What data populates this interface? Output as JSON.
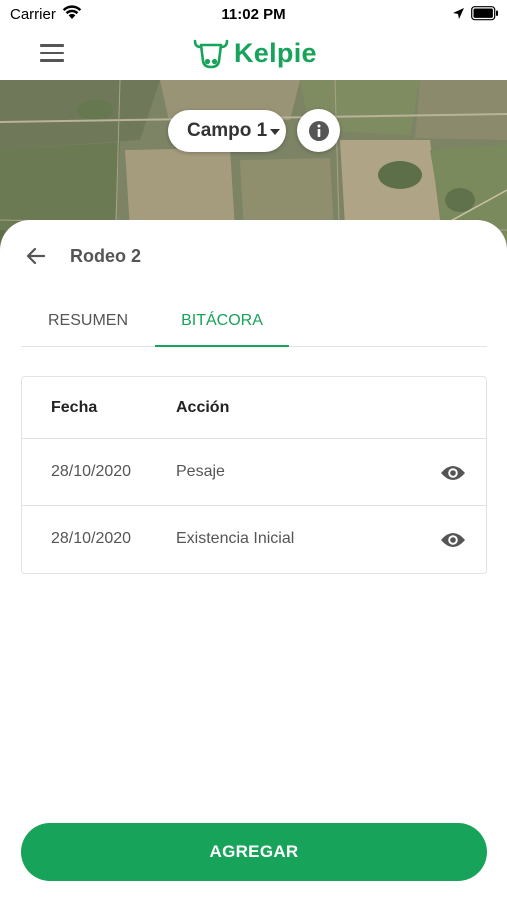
{
  "status_bar": {
    "carrier": "Carrier",
    "time": "11:02 PM"
  },
  "header": {
    "brand_name": "Kelpie",
    "brand_color": "#17a35a",
    "menu_icon": "hamburger-menu-icon",
    "logo_icon": "cow-head-icon"
  },
  "map": {
    "field_selector": "Campo 1",
    "info_icon": "info-icon"
  },
  "sheet": {
    "title": "Rodeo 2",
    "back_icon": "arrow-left-icon",
    "tabs": [
      {
        "label": "RESUMEN",
        "active": false
      },
      {
        "label": "BITÁCORA",
        "active": true
      }
    ],
    "table": {
      "headers": [
        "Fecha",
        "Acción"
      ],
      "rows": [
        {
          "fecha": "28/10/2020",
          "accion": "Pesaje",
          "icon": "eye-icon"
        },
        {
          "fecha": "28/10/2020",
          "accion": "Existencia Inicial",
          "icon": "eye-icon"
        }
      ]
    },
    "add_button": "AGREGAR"
  }
}
